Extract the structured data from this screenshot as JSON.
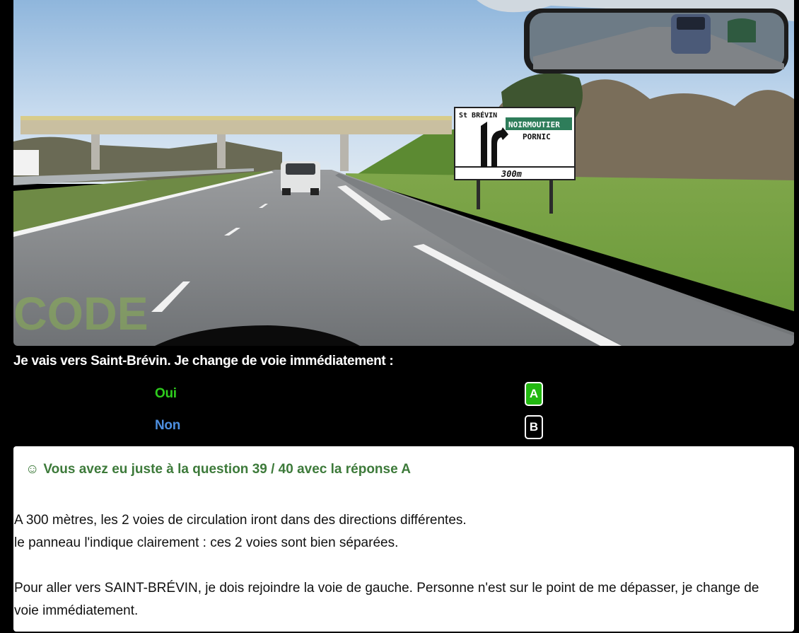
{
  "scene": {
    "sign": {
      "left_destination": "St BRÉVIN",
      "right_destination_1": "NOIRMOUTIER",
      "right_destination_2": "PORNIC",
      "distance": "300m"
    },
    "watermark": "CODE"
  },
  "question": {
    "text": "Je vais vers Saint-Brévin. Je change de voie immédiatement :",
    "answers": [
      {
        "label": "Oui",
        "badge": "A",
        "selected": true
      },
      {
        "label": "Non",
        "badge": "B",
        "selected": false
      }
    ]
  },
  "result": {
    "icon": "smiley-icon",
    "smile": "☺",
    "text": "Vous avez eu juste à la question 39 / 40 avec la réponse A"
  },
  "explanation": {
    "p1_line1": "A 300 mètres, les 2 voies de circulation iront dans des directions différentes.",
    "p1_line2": "le panneau l'indique clairement : ces 2 voies sont bien séparées.",
    "p2": "Pour aller vers SAINT-BRÉVIN, je dois rejoindre la voie de gauche. Personne n'est sur le point de me dépasser, je change de voie immédiatement."
  },
  "colors": {
    "correct_green": "#22b811",
    "answer_a": "#2ecc1d",
    "answer_b": "#4d8fe0",
    "result_text": "#3d7a3a"
  }
}
